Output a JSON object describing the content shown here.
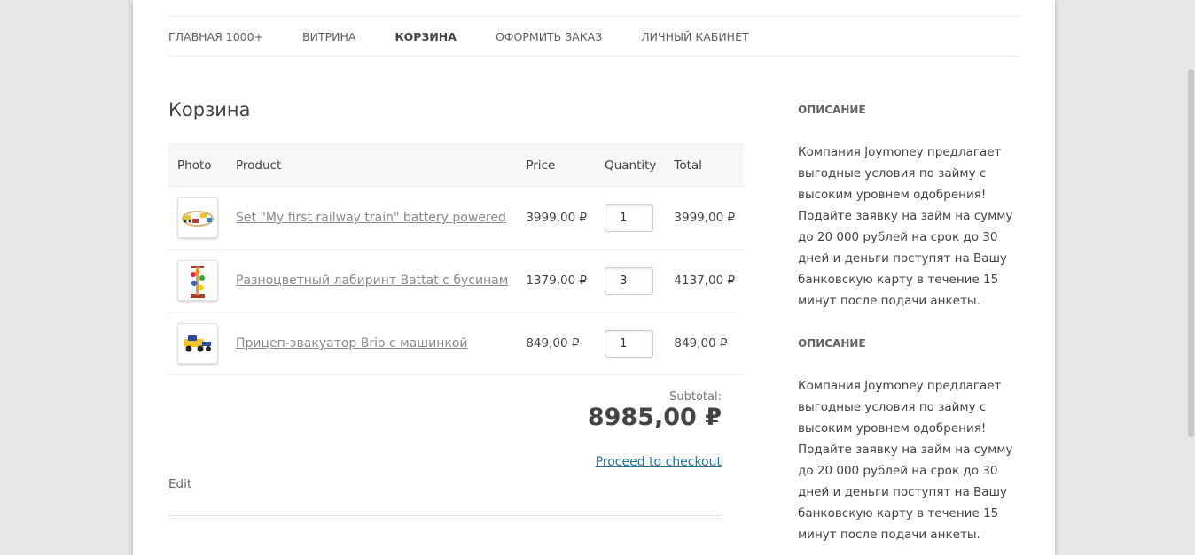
{
  "nav": {
    "items": [
      {
        "label": "Главная 1000+"
      },
      {
        "label": "Витрина"
      },
      {
        "label": "Корзина"
      },
      {
        "label": "Оформить заказ"
      },
      {
        "label": "Личный кабинет"
      }
    ]
  },
  "page_title": "Корзина",
  "cart": {
    "headers": {
      "photo": "Photo",
      "product": "Product",
      "price": "Price",
      "quantity": "Quantity",
      "total": "Total"
    },
    "rows": [
      {
        "name": "Set \"My first railway train\" battery powered",
        "price": "3999,00 ₽",
        "qty": "1",
        "total": "3999,00 ₽",
        "icon": "train-toy-icon"
      },
      {
        "name": "Разноцветный лабиринт Battat с бусинам",
        "price": "1379,00 ₽",
        "qty": "3",
        "total": "4137,00 ₽",
        "icon": "bead-maze-icon"
      },
      {
        "name": "Прицеп-эвакуатор Brio с машинкой",
        "price": "849,00 ₽",
        "qty": "1",
        "total": "849,00 ₽",
        "icon": "tow-truck-icon"
      }
    ],
    "subtotal_label": "Subtotal:",
    "subtotal_value": "8985,00 ₽",
    "checkout_label": "Proceed to checkout",
    "edit_label": "Edit"
  },
  "sidebar": {
    "widgets": [
      {
        "title": "Описание",
        "text": "Компания Joymoney предлагает выгодные условия по займу с высоким уровнем одобрения! Подайте заявку на займ на сумму до 20 000 рублей на срок до 30 дней и деньги поступят на Вашу банковскую карту в течение 15 минут после подачи анкеты."
      },
      {
        "title": "Описание",
        "text": "Компания Joymoney предлагает выгодные условия по займу с высоким уровнем одобрения! Подайте заявку на займ на сумму до 20 000 рублей на срок до 30 дней и деньги поступят на Вашу банковскую карту в течение 15 минут после подачи анкеты."
      }
    ]
  },
  "colors": {
    "link": "#21759b",
    "background": "#e6e6e6",
    "page": "#ffffff"
  }
}
